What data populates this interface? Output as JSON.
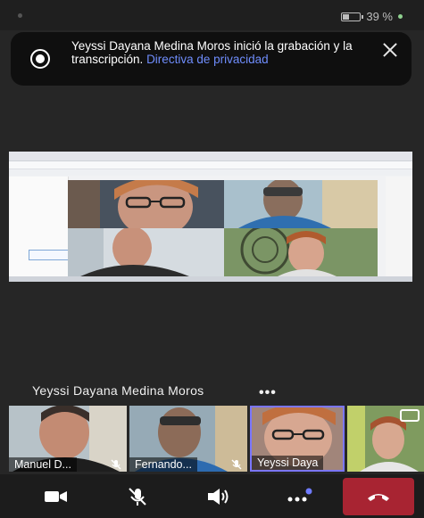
{
  "status_bar": {
    "battery_text": "39 %",
    "battery_level": 0.39
  },
  "banner": {
    "message": "Yeyssi Dayana Medina Moros inició la grabación y la transcripción.",
    "link": "Directiva de privacidad"
  },
  "active_speaker": {
    "name": "Yeyssi Dayana Medina Moros",
    "more_label": "•••"
  },
  "participants": [
    {
      "name": "Manuel D...",
      "muted": true
    },
    {
      "name": "Fernando...",
      "muted": true
    },
    {
      "name": "Yeyssi Daya",
      "muted": false,
      "active": true
    },
    {
      "name": "",
      "muted": false
    }
  ],
  "toolbar": [
    "video-icon",
    "mic-off-icon",
    "speaker-icon",
    "more-icon",
    "end-call-icon"
  ],
  "colors": {
    "end_call": "#a82432",
    "link": "#6f8dfc",
    "active_border": "#7b76ff"
  }
}
